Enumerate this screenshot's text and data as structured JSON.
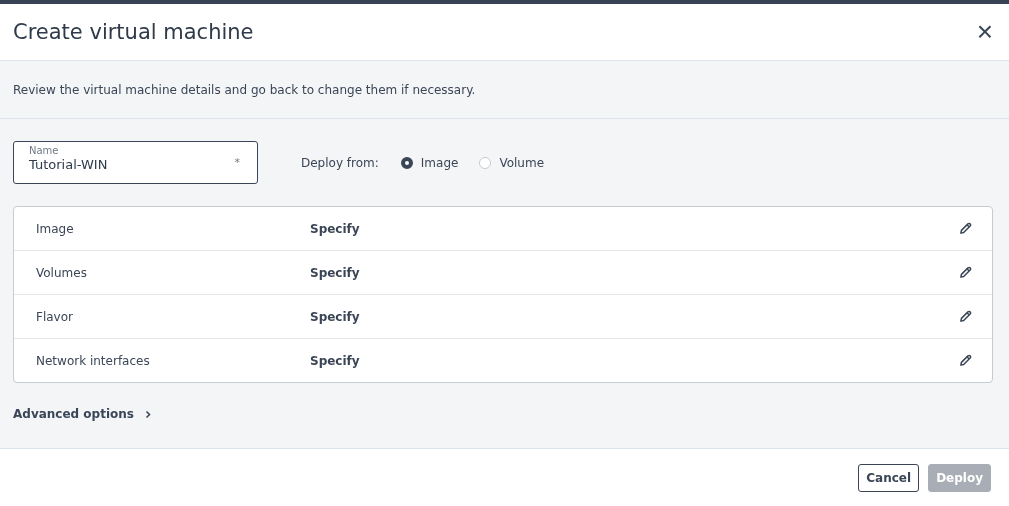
{
  "dialog": {
    "title": "Create virtual machine",
    "close_label": "×"
  },
  "description": "Review the virtual machine details and go back to change them if necessary.",
  "name_field": {
    "label": "Name",
    "value": "Tutorial-WIN",
    "required_mark": "*"
  },
  "deploy_from": {
    "label": "Deploy from:",
    "options": [
      {
        "label": "Image",
        "selected": true
      },
      {
        "label": "Volume",
        "selected": false
      }
    ]
  },
  "details": [
    {
      "name": "Image",
      "value": "Specify"
    },
    {
      "name": "Volumes",
      "value": "Specify"
    },
    {
      "name": "Flavor",
      "value": "Specify"
    },
    {
      "name": "Network interfaces",
      "value": "Specify"
    }
  ],
  "advanced_options": {
    "label": "Advanced options",
    "expanded": false
  },
  "buttons": [
    {
      "label": "Cancel",
      "kind": "secondary",
      "disabled": false
    },
    {
      "label": "Deploy",
      "kind": "primary",
      "disabled": true
    }
  ]
}
